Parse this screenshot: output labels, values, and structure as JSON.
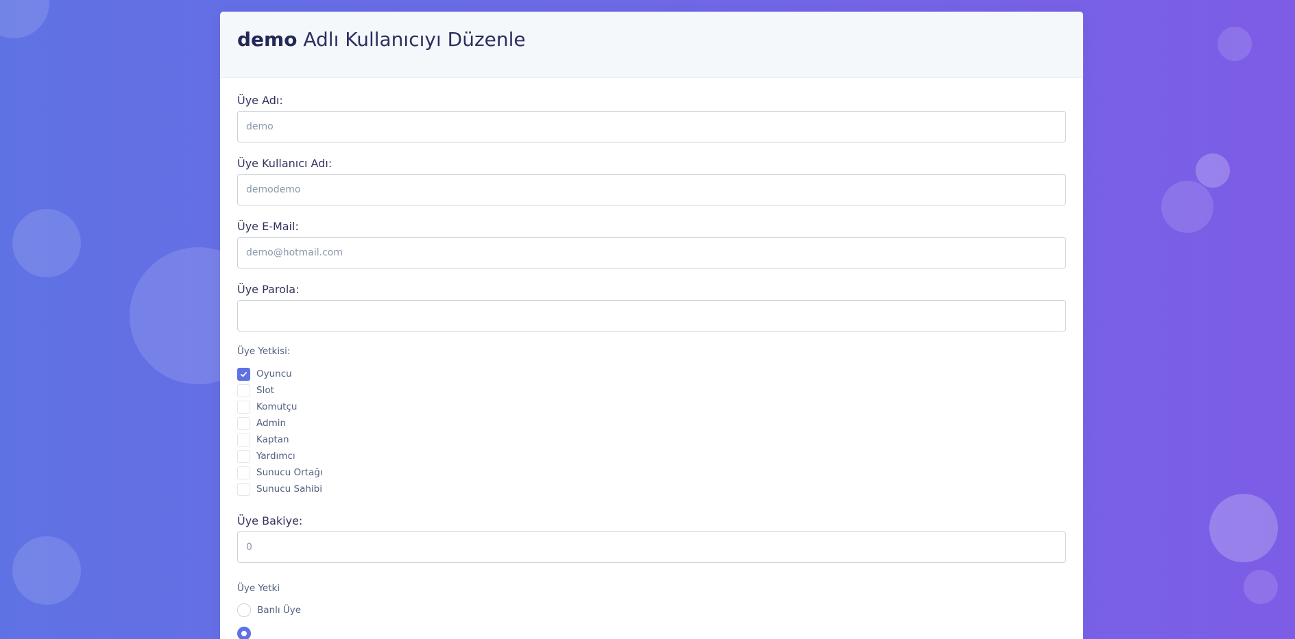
{
  "header": {
    "user_name": "demo",
    "title_suffix": "Adlı Kullanıcıyı Düzenle"
  },
  "fields": {
    "name": {
      "label": "Üye Adı:",
      "placeholder": "demo"
    },
    "username": {
      "label": "Üye Kullanıcı Adı:",
      "placeholder": "demodemo"
    },
    "email": {
      "label": "Üye E-Mail:",
      "placeholder": "demo@hotmail.com"
    },
    "password": {
      "label": "Üye Parola:",
      "placeholder": ""
    },
    "balance": {
      "label": "Üye Bakiye:",
      "placeholder": "0"
    }
  },
  "roles": {
    "label": "Üye Yetkisi:",
    "items": [
      {
        "label": "Oyuncu",
        "checked": true
      },
      {
        "label": "Slot",
        "checked": false
      },
      {
        "label": "Komutçu",
        "checked": false
      },
      {
        "label": "Admin",
        "checked": false
      },
      {
        "label": "Kaptan",
        "checked": false
      },
      {
        "label": "Yardımcı",
        "checked": false
      },
      {
        "label": "Sunucu Ortağı",
        "checked": false
      },
      {
        "label": "Sunucu Sahibi",
        "checked": false
      }
    ]
  },
  "status": {
    "label": "Üye Yetki",
    "options": [
      {
        "label": "Banlı Üye",
        "checked": false
      },
      {
        "label": "",
        "checked": true
      }
    ]
  },
  "colors": {
    "accent": "#5e72e4",
    "background_start": "#5f72e4",
    "background_end": "#7d5de6"
  }
}
